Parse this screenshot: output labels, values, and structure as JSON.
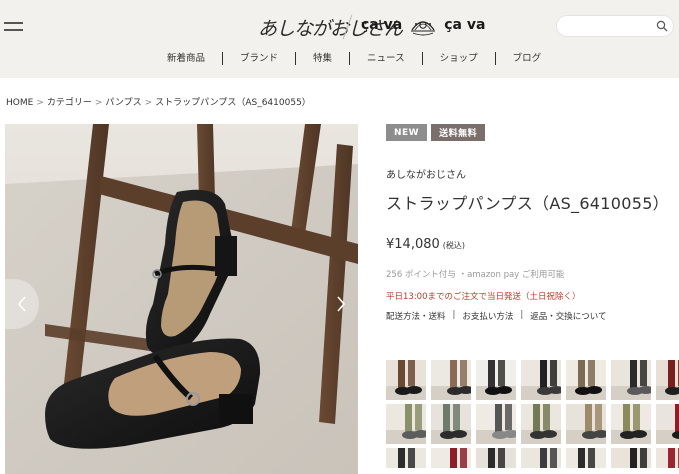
{
  "header": {
    "logo_text": "あしながおじさん",
    "cava_text": "ça va",
    "cava_text_2": "ça va",
    "search_placeholder": ""
  },
  "nav": {
    "items": [
      {
        "label": "新着商品"
      },
      {
        "label": "ブランド"
      },
      {
        "label": "特集"
      },
      {
        "label": "ニュース"
      },
      {
        "label": "ショップ"
      },
      {
        "label": "ブログ"
      }
    ]
  },
  "breadcrumb": {
    "items": [
      {
        "label": "HOME"
      },
      {
        "label": "カテゴリー"
      },
      {
        "label": "パンプス"
      },
      {
        "label": "ストラップパンプス（AS_6410055）"
      }
    ],
    "separator": ">"
  },
  "product": {
    "badges": {
      "new": "NEW",
      "shipping": "送料無料"
    },
    "brand": "あしながおじさん",
    "title": "ストラップパンプス（AS_6410055）",
    "price": "¥14,080",
    "tax_note": "(税込)",
    "points": "256 ポイント付与 ・amazon pay ご利用可能",
    "notice": "平日13:00までのご注文で当日発送（土日祝除く）",
    "links": [
      "配送方法・送料",
      "お支払い方法",
      "返品・交換について"
    ],
    "links_separator": "|"
  },
  "colors": {
    "header_bg": "#f2f1ee",
    "badge_new": "#8d8d8d",
    "badge_shipping": "#7a6f6b",
    "notice_red": "#c0392b"
  },
  "icons": {
    "menu": "hamburger-icon",
    "search": "search-icon",
    "prev": "chevron-left-icon",
    "next": "chevron-right-icon"
  }
}
